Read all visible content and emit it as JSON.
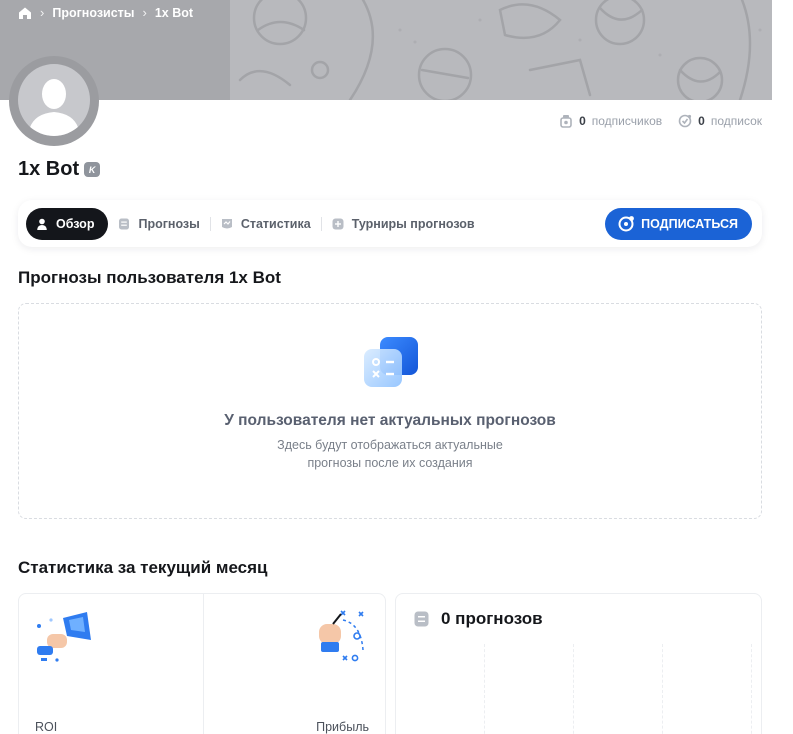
{
  "breadcrumb": {
    "home_icon": "home-icon",
    "items": [
      "Прогнозисты",
      "1x Bot"
    ],
    "separator": "›"
  },
  "profile": {
    "name": "1x Bot",
    "badge": "K",
    "avatar": "default-user-avatar"
  },
  "counters": {
    "subscribers": {
      "value": "0",
      "label": "подписчиков",
      "icon": "subscribers-icon"
    },
    "subscriptions": {
      "value": "0",
      "label": "подписок",
      "icon": "subscriptions-icon"
    }
  },
  "tabs": [
    {
      "label": "Обзор",
      "icon": "user-icon",
      "active": true
    },
    {
      "label": "Прогнозы",
      "icon": "list-icon",
      "active": false
    },
    {
      "label": "Статистика",
      "icon": "chart-icon",
      "active": false
    },
    {
      "label": "Турниры прогнозов",
      "icon": "plus-icon",
      "active": false
    }
  ],
  "subscribe_button": {
    "label": "ПОДПИСАТЬСЯ",
    "icon": "subscribe-icon"
  },
  "forecasts_section": {
    "title": "Прогнозы пользователя 1x Bot",
    "empty_title": "У пользователя нет актуальных прогнозов",
    "empty_subtitle_lines": [
      "Здесь будут отображаться актуальные",
      "прогнозы после их создания"
    ]
  },
  "stats_section": {
    "title": "Статистика за текущий месяц",
    "roi_label": "ROI",
    "profit_label": "Прибыль",
    "forecasts_count": "0 прогнозов"
  },
  "colors": {
    "accent": "#1b63d6",
    "active_tab": "#14161b",
    "banner": "#b8b9bd"
  }
}
